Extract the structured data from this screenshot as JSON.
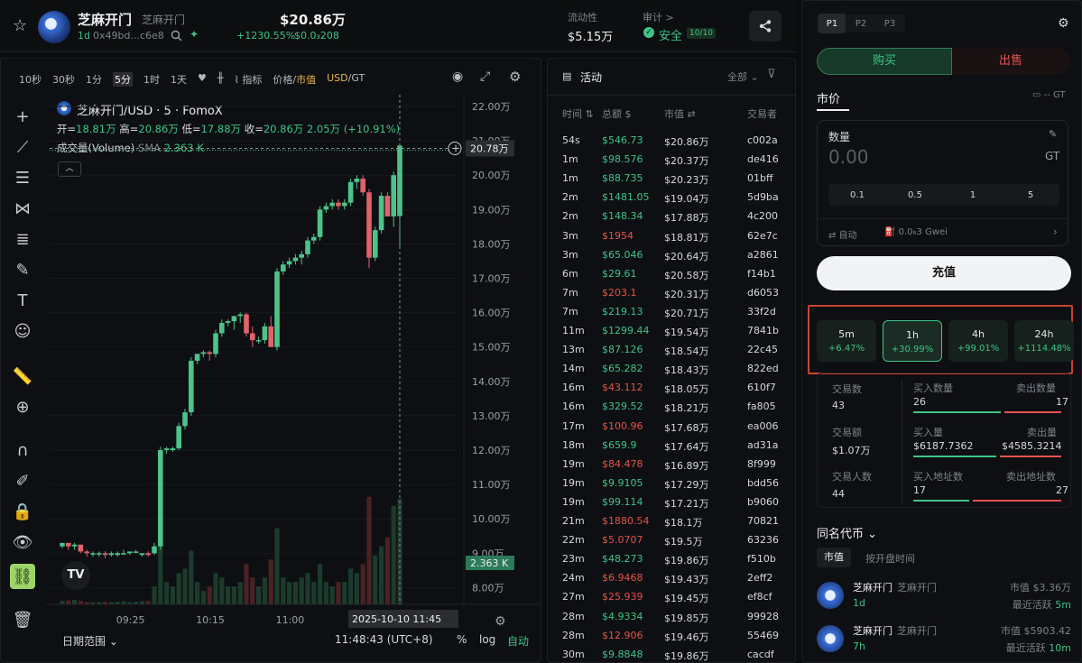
{
  "token": {
    "name": "芝麻开门",
    "alias": "芝麻开门",
    "age": "1d",
    "address": "0x49bd...c6e8",
    "price": "$20.86万",
    "change": "+1230.55%",
    "sub_price": "$0.0₃208"
  },
  "header_stats": {
    "liquidity_label": "流动性",
    "liquidity_value": "$5.15万",
    "audit_label": "审计",
    "audit_arrow": ">",
    "safe_label": "安全",
    "safe_score": "10/10"
  },
  "chart_toolbar": {
    "intervals": [
      "10秒",
      "30秒",
      "1分",
      "5分",
      "1时",
      "1天"
    ],
    "active_interval": "5分",
    "indicator": "指标",
    "price_label": "价格",
    "mcap_label": "市值",
    "sep": "/",
    "currency": "USD",
    "currency2": "GT"
  },
  "chart_info": {
    "symbol": "芝麻开门/USD · 5 · FomoX",
    "open_label": "开=",
    "open": "18.81万",
    "high_label": "高=",
    "high": "20.86万",
    "low_label": "低=",
    "low": "17.88万",
    "close_label": "收=",
    "close": "20.86万",
    "chg": "2.05万 (+10.91%)",
    "volume_label": "成交量(Volume)",
    "sma_label": "SMA",
    "sma_value": "2.363 K"
  },
  "chart_data": {
    "type": "candlestick",
    "y_ticks": [
      "22.00万",
      "21.00万",
      "20.00万",
      "19.00万",
      "18.00万",
      "17.00万",
      "16.00万",
      "15.00万",
      "14.00万",
      "13.00万",
      "12.00万",
      "11.00万",
      "10.00万",
      "9.00万",
      "8.00万"
    ],
    "x_ticks": [
      "09:25",
      "10:15",
      "11:00",
      "11:45"
    ],
    "crosshair_date": "2025-10-10",
    "current_price_label": "20.78万",
    "current_vol_label": "2.363 K",
    "candles": [
      [
        9.2,
        9.3,
        9.15,
        9.3
      ],
      [
        9.3,
        9.3,
        9.1,
        9.2
      ],
      [
        9.2,
        9.3,
        9.1,
        9.25
      ],
      [
        9.25,
        9.25,
        9.0,
        9.05
      ],
      [
        9.05,
        9.1,
        8.9,
        9.0
      ],
      [
        9.0,
        9.05,
        8.9,
        9.0
      ],
      [
        9.0,
        9.05,
        8.9,
        9.0
      ],
      [
        9.0,
        9.05,
        8.85,
        8.95
      ],
      [
        8.95,
        9.05,
        8.9,
        9.0
      ],
      [
        8.95,
        9.05,
        8.9,
        9.0
      ],
      [
        9.0,
        9.1,
        8.95,
        9.0
      ],
      [
        9.0,
        9.05,
        8.95,
        9.05
      ],
      [
        9.05,
        9.1,
        9.0,
        9.05
      ],
      [
        8.95,
        9.0,
        8.9,
        9.0
      ],
      [
        9.0,
        9.05,
        8.9,
        8.95
      ],
      [
        9.0,
        9.3,
        8.95,
        9.2
      ],
      [
        9.2,
        12.1,
        9.1,
        12.0
      ],
      [
        12.0,
        12.1,
        11.9,
        12.05
      ],
      [
        12.0,
        12.1,
        11.95,
        12.05
      ],
      [
        12.05,
        12.8,
        12.0,
        12.7
      ],
      [
        12.7,
        13.2,
        12.6,
        13.1
      ],
      [
        13.1,
        14.7,
        13.0,
        14.6
      ],
      [
        14.6,
        14.8,
        14.5,
        14.8
      ],
      [
        14.8,
        14.9,
        14.7,
        14.85
      ],
      [
        14.85,
        14.9,
        14.6,
        14.8
      ],
      [
        14.8,
        15.5,
        14.7,
        15.4
      ],
      [
        15.4,
        15.8,
        15.3,
        15.7
      ],
      [
        15.7,
        15.8,
        15.6,
        15.75
      ],
      [
        15.75,
        15.9,
        15.5,
        15.9
      ],
      [
        15.9,
        16.0,
        15.7,
        15.95
      ],
      [
        15.95,
        16.0,
        15.3,
        15.4
      ],
      [
        15.4,
        15.6,
        15.0,
        15.2
      ],
      [
        15.2,
        15.3,
        15.1,
        15.2
      ],
      [
        15.2,
        15.7,
        15.1,
        15.6
      ],
      [
        15.6,
        15.9,
        15.0,
        15.0
      ],
      [
        15.0,
        17.3,
        14.9,
        17.2
      ],
      [
        17.2,
        17.5,
        17.1,
        17.4
      ],
      [
        17.4,
        17.6,
        17.3,
        17.5
      ],
      [
        17.5,
        17.7,
        17.4,
        17.6
      ],
      [
        17.6,
        17.8,
        17.4,
        17.7
      ],
      [
        17.7,
        18.2,
        17.6,
        18.1
      ],
      [
        18.1,
        18.3,
        18.0,
        18.2
      ],
      [
        18.2,
        19.1,
        18.1,
        19.0
      ],
      [
        19.0,
        19.2,
        18.9,
        19.1
      ],
      [
        19.1,
        19.3,
        19.0,
        19.2
      ],
      [
        19.2,
        19.3,
        19.0,
        19.1
      ],
      [
        19.1,
        19.3,
        19.0,
        19.2
      ],
      [
        19.2,
        19.9,
        19.1,
        19.8
      ],
      [
        19.8,
        20.0,
        19.6,
        19.9
      ],
      [
        19.9,
        20.0,
        19.4,
        19.5
      ],
      [
        19.5,
        19.6,
        17.3,
        17.6
      ],
      [
        17.6,
        18.5,
        17.5,
        18.4
      ],
      [
        18.4,
        19.5,
        18.3,
        19.4
      ],
      [
        19.4,
        19.5,
        18.8,
        18.8
      ],
      [
        18.8,
        20.1,
        18.5,
        20.0
      ],
      [
        18.81,
        20.86,
        17.88,
        20.86
      ]
    ],
    "volumes": [
      0.08,
      0.09,
      0.1,
      0.08,
      0.05,
      0.05,
      0.05,
      0.06,
      0.05,
      0.06,
      0.07,
      0.05,
      0.06,
      0.07,
      0.08,
      0.4,
      1.3,
      0.5,
      0.4,
      0.7,
      0.8,
      1.2,
      0.5,
      0.3,
      0.4,
      0.7,
      0.6,
      0.4,
      0.4,
      0.5,
      0.9,
      0.6,
      0.4,
      0.6,
      1.0,
      1.7,
      0.6,
      0.5,
      0.5,
      0.6,
      0.7,
      0.5,
      0.9,
      0.5,
      0.4,
      0.5,
      0.5,
      0.8,
      0.7,
      0.9,
      2.4,
      1.1,
      1.3,
      1.5,
      2.2,
      2.36
    ]
  },
  "chart_footer": {
    "date_range": "日期范围",
    "time": "11:48:43 (UTC+8)",
    "pct": "%",
    "log": "log",
    "auto": "自动"
  },
  "activity": {
    "title": "活动",
    "filter": "全部",
    "columns": [
      "时间",
      "总额",
      "市值",
      "交易者"
    ],
    "rows": [
      [
        "54s",
        "$546.73",
        "$20.86万",
        "c002a",
        "b"
      ],
      [
        "1m",
        "$98.576",
        "$20.37万",
        "de416",
        "b"
      ],
      [
        "1m",
        "$88.735",
        "$20.23万",
        "01bff",
        "b"
      ],
      [
        "2m",
        "$1481.05",
        "$19.04万",
        "5d9ba",
        "b"
      ],
      [
        "2m",
        "$148.34",
        "$17.88万",
        "4c200",
        "b"
      ],
      [
        "3m",
        "$1954",
        "$18.81万",
        "62e7c",
        "s"
      ],
      [
        "3m",
        "$65.046",
        "$20.64万",
        "a2861",
        "b"
      ],
      [
        "6m",
        "$29.61",
        "$20.58万",
        "f14b1",
        "b"
      ],
      [
        "7m",
        "$203.1",
        "$20.31万",
        "d6053",
        "s"
      ],
      [
        "7m",
        "$219.13",
        "$20.71万",
        "33f2d",
        "b"
      ],
      [
        "11m",
        "$1299.44",
        "$19.54万",
        "7841b",
        "b"
      ],
      [
        "13m",
        "$87.126",
        "$18.54万",
        "22c45",
        "b"
      ],
      [
        "14m",
        "$65.282",
        "$18.43万",
        "822ed",
        "b"
      ],
      [
        "16m",
        "$43.112",
        "$18.05万",
        "610f7",
        "s"
      ],
      [
        "16m",
        "$329.52",
        "$18.21万",
        "fa805",
        "b"
      ],
      [
        "17m",
        "$100.96",
        "$17.68万",
        "ea006",
        "s"
      ],
      [
        "18m",
        "$659.9",
        "$17.64万",
        "ad31a",
        "b"
      ],
      [
        "19m",
        "$84.478",
        "$16.89万",
        "8f999",
        "s"
      ],
      [
        "19m",
        "$9.9105",
        "$17.29万",
        "bdd56",
        "b"
      ],
      [
        "19m",
        "$99.114",
        "$17.21万",
        "b9060",
        "b"
      ],
      [
        "21m",
        "$1880.54",
        "$18.1万",
        "70821",
        "s"
      ],
      [
        "22m",
        "$5.0707",
        "$19.5万",
        "63236",
        "s"
      ],
      [
        "23m",
        "$48.273",
        "$19.86万",
        "f510b",
        "b"
      ],
      [
        "24m",
        "$6.9468",
        "$19.43万",
        "2eff2",
        "s"
      ],
      [
        "27m",
        "$25.939",
        "$19.45万",
        "ef8cf",
        "s"
      ],
      [
        "28m",
        "$4.9334",
        "$19.85万",
        "99928",
        "b"
      ],
      [
        "28m",
        "$12.906",
        "$19.46万",
        "55469",
        "s"
      ],
      [
        "30m",
        "$9.8848",
        "$19.86万",
        "cacdf",
        "b"
      ]
    ]
  },
  "trade": {
    "presets": [
      "P1",
      "P2",
      "P3"
    ],
    "buy": "购买",
    "sell": "出售",
    "market": "市价",
    "gt_label": "-- GT",
    "qty_label": "数量",
    "qty_placeholder": "0.00",
    "qty_unit": "GT",
    "quick": [
      "0.1",
      "0.5",
      "1",
      "5"
    ],
    "auto": "自动",
    "gas": "0.0₈3 Gwei",
    "charge": "充值"
  },
  "timeframes": [
    {
      "label": "5m",
      "chg": "+6.47%"
    },
    {
      "label": "1h",
      "chg": "+30.99%"
    },
    {
      "label": "4h",
      "chg": "+99.01%"
    },
    {
      "label": "24h",
      "chg": "+1114.48%"
    }
  ],
  "stats": {
    "tx_label": "交易数",
    "tx": "43",
    "vol_label": "交易额",
    "vol": "$1.07万",
    "users_label": "交易人数",
    "users": "44",
    "buy_cnt_label": "买入数量",
    "buy_cnt": "26",
    "sell_cnt_label": "卖出数量",
    "sell_cnt": "17",
    "buy_vol_label": "买入量",
    "buy_vol": "$6187.7362",
    "sell_vol_label": "卖出量",
    "sell_vol": "$4585.3214",
    "buy_addr_label": "买入地址数",
    "buy_addr": "17",
    "sell_addr_label": "卖出地址数",
    "sell_addr": "27"
  },
  "same_name": {
    "title": "同名代币",
    "tab_mcap": "市值",
    "tab_time": "按开盘时间",
    "items": [
      {
        "name": "芝麻开门",
        "alias": "芝麻开门",
        "age": "1d",
        "mcap": "市值 $3.36万",
        "active": "最近活跃 5m"
      },
      {
        "name": "芝麻开门",
        "alias": "芝麻开门",
        "age": "7h",
        "mcap": "市值 $5903.42",
        "active": "最近活跃 10m"
      }
    ]
  }
}
